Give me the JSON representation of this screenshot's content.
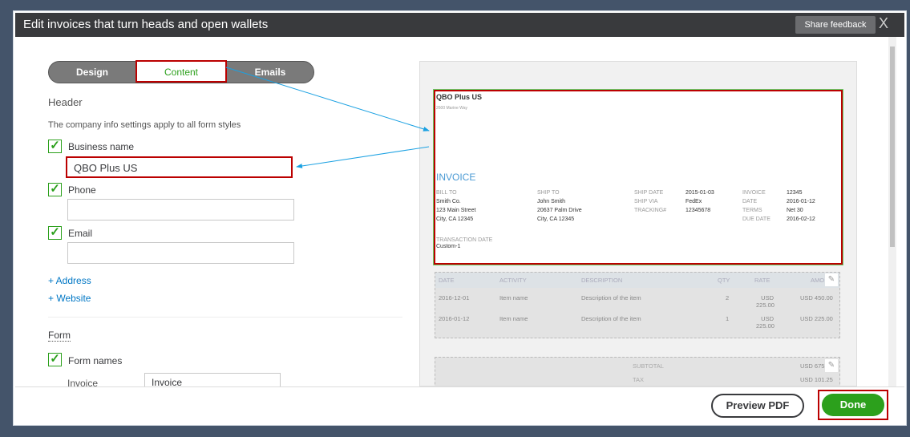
{
  "window": {
    "title": "Edit invoices that turn heads and open wallets",
    "share_feedback": "Share feedback",
    "close": "X"
  },
  "tabs": [
    "Design",
    "Content",
    "Emails"
  ],
  "header": {
    "title": "Header",
    "note": "The company info settings apply to all form styles",
    "business_name_label": "Business name",
    "business_name_value": "QBO Plus US",
    "phone_label": "Phone",
    "email_label": "Email",
    "add_address": "+ Address",
    "add_website": "+ Website"
  },
  "form": {
    "title": "Form",
    "form_names_label": "Form names",
    "invoice_label": "Invoice",
    "invoice_value": "Invoice"
  },
  "invoice_preview": {
    "company": "QBO Plus US",
    "address": "2600 Marine Way",
    "heading": "INVOICE",
    "bill_to_label": "BILL TO",
    "bill_to": [
      "Smith Co.",
      "123 Main Street",
      "City, CA 12345"
    ],
    "ship_to_label": "SHIP TO",
    "ship_to": [
      "John Smith",
      "20637 Palm Drive",
      "City, CA 12345"
    ],
    "ship_fields": [
      [
        "SHIP DATE",
        "2015-01-03"
      ],
      [
        "SHIP VIA",
        "FedEx"
      ],
      [
        "TRACKING#",
        "12345678"
      ]
    ],
    "inv_fields": [
      [
        "INVOICE",
        "12345"
      ],
      [
        "DATE",
        "2016-01-12"
      ],
      [
        "TERMS",
        "Net 30"
      ],
      [
        "DUE DATE",
        "2016-02-12"
      ]
    ],
    "transaction_date_label": "TRANSACTION DATE",
    "transaction_date": "Custom-1",
    "columns": [
      "DATE",
      "ACTIVITY",
      "DESCRIPTION",
      "QTY",
      "RATE",
      "AMO"
    ],
    "rows": [
      [
        "2016-12-01",
        "Item name",
        "Description of the item",
        "2",
        "USD 225.00",
        "USD 450.00"
      ],
      [
        "2016-01-12",
        "Item name",
        "Description of the item",
        "1",
        "USD 225.00",
        "USD 225.00"
      ]
    ],
    "subtotal_label": "SUBTOTAL",
    "subtotal": "USD 675",
    "tax_label": "TAX",
    "tax": "USD 101.25"
  },
  "footer": {
    "preview_pdf": "Preview PDF",
    "done": "Done"
  },
  "colors": {
    "accent": "#2ca01c",
    "highlight": "#bb0000",
    "link": "#0077c5",
    "arrow": "#1ba1e2"
  }
}
